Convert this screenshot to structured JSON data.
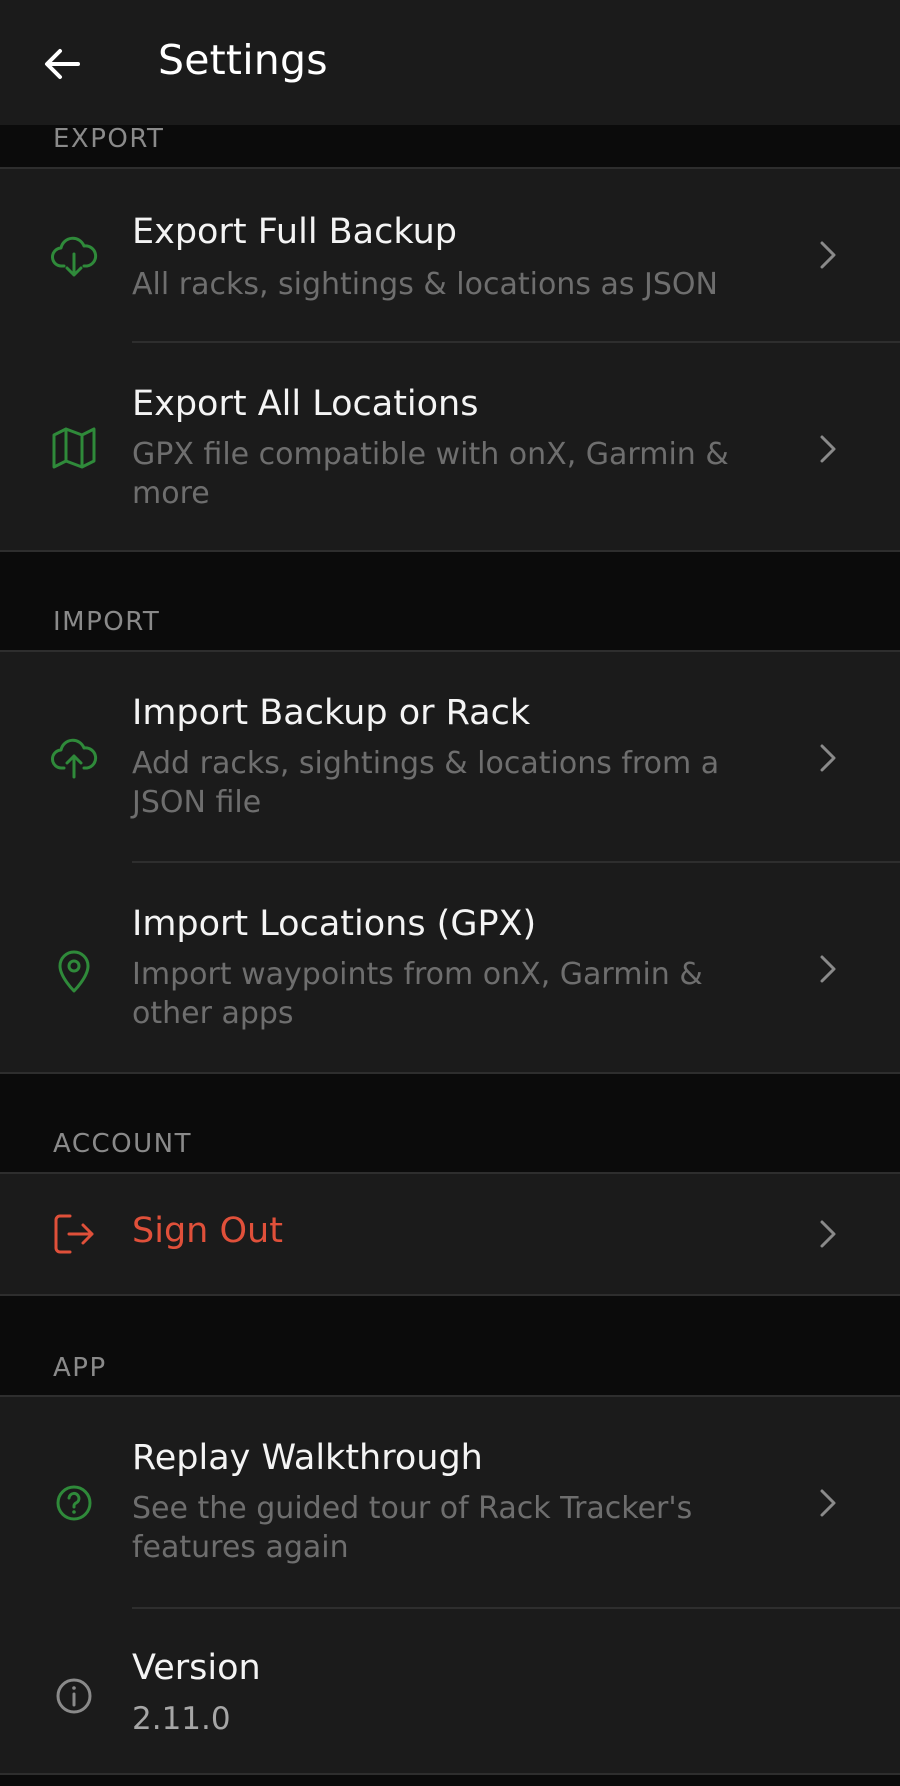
{
  "header": {
    "title": "Settings",
    "back_icon": "arrow-left-icon"
  },
  "sections": {
    "export": {
      "label": "EXPORT",
      "items": [
        {
          "label": "Export Full Backup",
          "sub": "All racks, sightings & locations as JSON",
          "icon": "cloud-download-icon"
        },
        {
          "label": "Export All Locations",
          "sub": "GPX file compatible with onX, Garmin & more",
          "icon": "map-icon"
        }
      ]
    },
    "import": {
      "label": "IMPORT",
      "items": [
        {
          "label": "Import Backup or Rack",
          "sub": "Add racks, sightings & locations from a JSON file",
          "icon": "cloud-upload-icon"
        },
        {
          "label": "Import Locations (GPX)",
          "sub": "Import waypoints from onX, Garmin & other apps",
          "icon": "map-pin-icon"
        }
      ]
    },
    "account": {
      "label": "ACCOUNT",
      "items": [
        {
          "label": "Sign Out",
          "icon": "sign-out-icon"
        }
      ]
    },
    "app": {
      "label": "APP",
      "items": [
        {
          "label": "Replay Walkthrough",
          "sub": "See the guided tour of Rack Tracker's features again",
          "icon": "help-circle-icon"
        },
        {
          "label": "Version",
          "value": "2.11.0",
          "icon": "info-icon"
        }
      ]
    }
  },
  "colors": {
    "accent_green": "#2f8a3a",
    "danger_red": "#e0503a",
    "background": "#0b0b0b",
    "card": "#1b1b1b"
  }
}
